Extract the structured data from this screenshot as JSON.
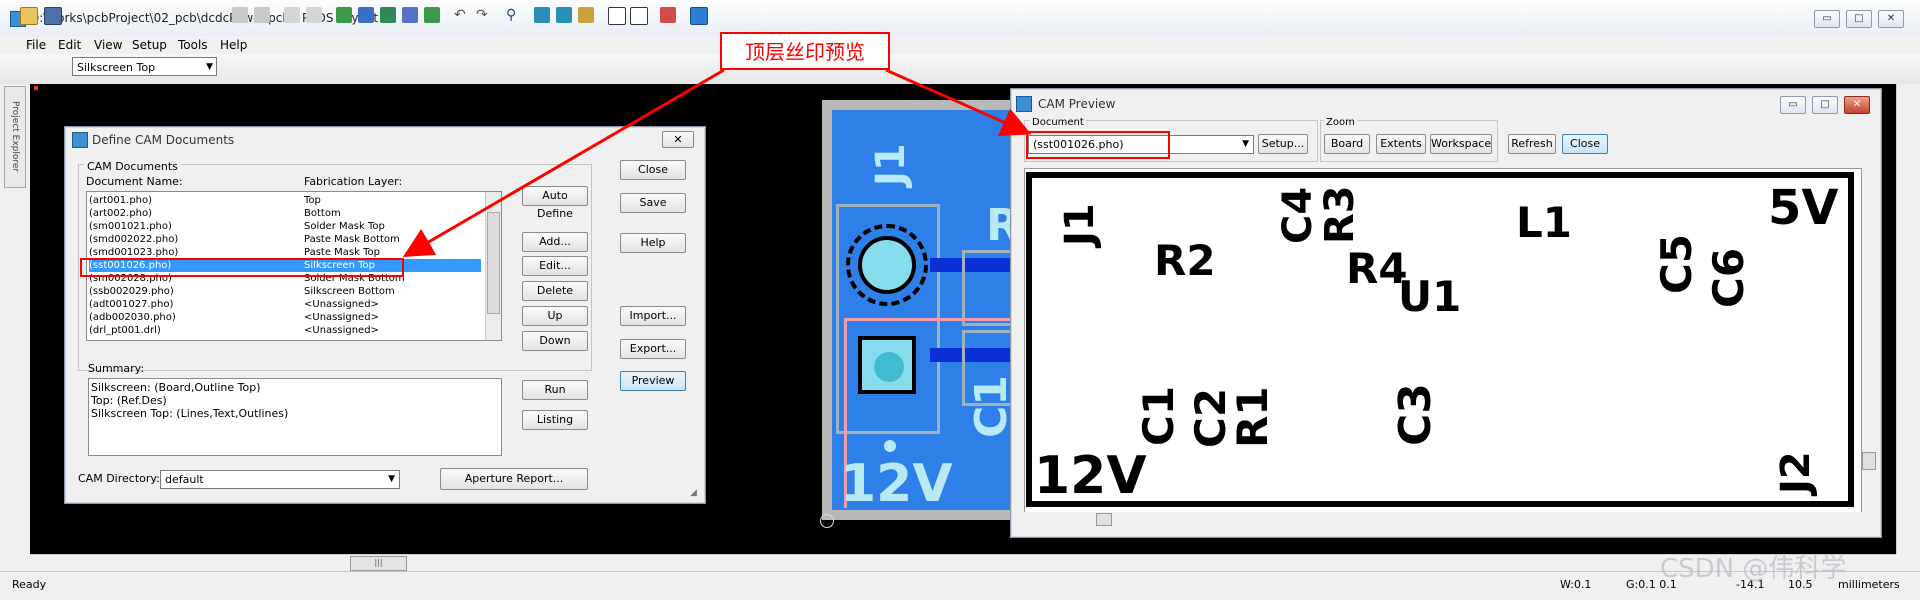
{
  "window": {
    "title": "D:\\works\\pcbProject\\02_pcb\\dcdcPower.pcb - PADS Layout",
    "minimize": "▭",
    "maximize": "□",
    "close": "✕"
  },
  "menu": [
    "File",
    "Edit",
    "View",
    "Setup",
    "Tools",
    "Help"
  ],
  "toolbar": {
    "layer": "Silkscreen Top"
  },
  "left_panel": {
    "label": "Project Explorer"
  },
  "annotation": {
    "text": "顶层丝印预览"
  },
  "define_cam": {
    "title": "Define CAM Documents",
    "group_label": "CAM Documents",
    "col_name": "Document Name:",
    "col_layer": "Fabrication Layer:",
    "rows": [
      {
        "name": "(art001.pho)",
        "layer": "Top"
      },
      {
        "name": "(art002.pho)",
        "layer": "Bottom"
      },
      {
        "name": "(sm001021.pho)",
        "layer": "Solder Mask Top"
      },
      {
        "name": "(smd002022.pho)",
        "layer": "Paste Mask Bottom"
      },
      {
        "name": "(smd001023.pho)",
        "layer": "Paste Mask Top"
      },
      {
        "name": "(sst001026.pho)",
        "layer": "Silkscreen Top"
      },
      {
        "name": "(sm002028.pho)",
        "layer": "Solder Mask Bottom"
      },
      {
        "name": "(ssb002029.pho)",
        "layer": "Silkscreen Bottom"
      },
      {
        "name": "(adt001027.pho)",
        "layer": "<Unassigned>"
      },
      {
        "name": "(adb002030.pho)",
        "layer": "<Unassigned>"
      },
      {
        "name": "(drl_pt001.drl)",
        "layer": "<Unassigned>"
      }
    ],
    "buttons_mid": [
      "Auto Define",
      "Add...",
      "Edit...",
      "Delete",
      "Up",
      "Down",
      "Run",
      "Listing"
    ],
    "buttons_right": [
      "Close",
      "Save",
      "Help",
      "Import...",
      "Export...",
      "Preview"
    ],
    "summary_label": "Summary:",
    "summary_lines": [
      "Silkscreen: (Board,Outline Top)",
      "Top: (Ref.Des)",
      "Silkscreen Top: (Lines,Text,Outlines)"
    ],
    "cam_dir_label": "CAM Directory:",
    "cam_dir_value": "default",
    "aperture_button": "Aperture Report..."
  },
  "cam_preview": {
    "title": "CAM Preview",
    "document_label": "Document",
    "document_value": "(sst001026.pho)",
    "setup_button": "Setup...",
    "zoom_label": "Zoom",
    "zoom_buttons": [
      "Board",
      "Extents",
      "Workspace"
    ],
    "refresh_button": "Refresh",
    "close_button": "Close",
    "silk_labels": [
      "J1",
      "R2",
      "C4",
      "R3",
      "R4",
      "U1",
      "L1",
      "C5",
      "C6",
      "5V",
      "C1",
      "C2",
      "R1",
      "C3",
      "12V",
      "J2"
    ]
  },
  "pcb_labels": {
    "j1": "J1",
    "v12": "12V",
    "c1": "C1",
    "r": "R"
  },
  "status": {
    "ready": "Ready",
    "w": "W:0.1",
    "g": "G:0.1 0.1",
    "x": "-14.1",
    "y": "10.5",
    "units": "millimeters"
  },
  "watermark": "CSDN @伟科学",
  "colors": {
    "accent": "#ff0000",
    "board": "#2f7fe8",
    "selection": "#3399ff"
  }
}
